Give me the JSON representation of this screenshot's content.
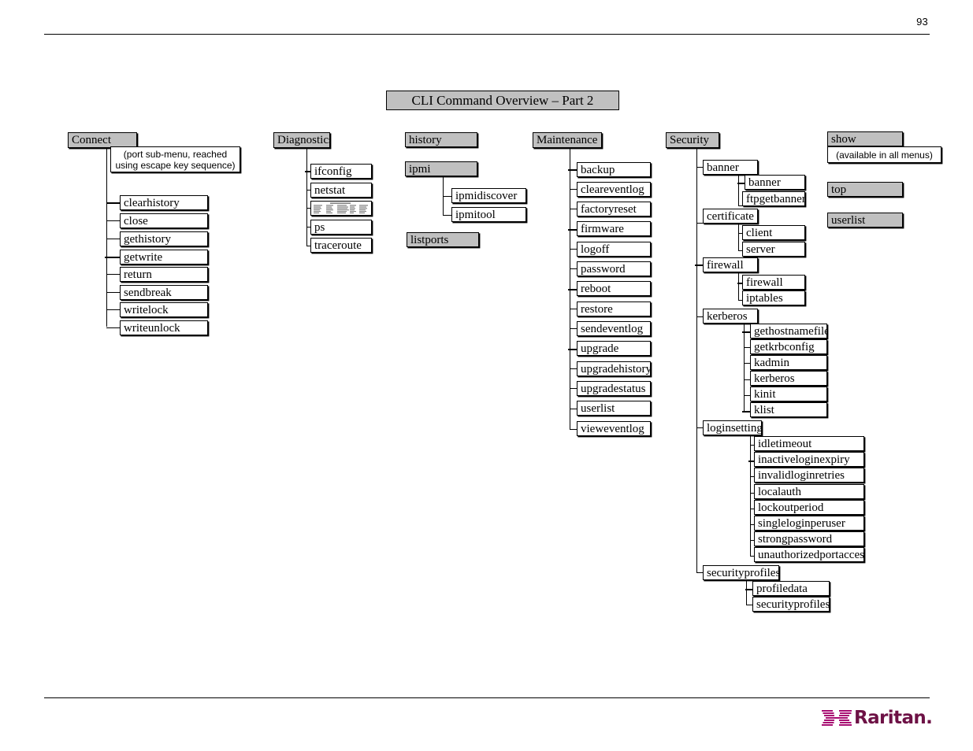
{
  "page": {
    "number": "93",
    "title": "CLI Command Overview – Part 2",
    "logo_text": "Raritan.",
    "logo_mark_name": "raritan-bowtie-logo-icon",
    "accent_color": "#6d1145",
    "logo_mark_color": "#a4006b",
    "header_box_color": "#c0c0c0"
  },
  "columns": [
    {
      "id": "connect",
      "root": "Connect",
      "note": "(port sub-menu, reached using escape key sequence)",
      "note_lines": [
        "(port sub-menu, reached",
        "using escape key sequence)"
      ],
      "children": [
        "clearhistory",
        "close",
        "gethistory",
        "getwrite",
        "return",
        "sendbreak",
        "writelock",
        "writeunlock"
      ]
    },
    {
      "id": "diagnostics",
      "root": "Diagnostics",
      "children": [
        "ifconfig",
        "netstat",
        "",
        "ps",
        "traceroute"
      ],
      "embedded_graphic_index": 2,
      "embedded_graphic_name": "netstat-output-thumbnail"
    },
    {
      "id": "history",
      "root": "history",
      "children": []
    },
    {
      "id": "ipmi",
      "root": "ipmi",
      "children": [
        "ipmidiscover",
        "ipmitool"
      ]
    },
    {
      "id": "listports",
      "root": "listports",
      "children": []
    },
    {
      "id": "maintenance",
      "root": "Maintenance",
      "children": [
        "backup",
        "cleareventlog",
        "factoryreset",
        "firmware",
        "logoff",
        "password",
        "reboot",
        "restore",
        "sendeventlog",
        "upgrade",
        "upgradehistory",
        "upgradestatus",
        "userlist",
        "vieweventlog"
      ]
    },
    {
      "id": "security",
      "root": "Security",
      "groups": [
        {
          "label": "banner",
          "children": [
            "banner",
            "ftpgetbanner"
          ]
        },
        {
          "label": "certificate",
          "children": [
            "client",
            "server"
          ]
        },
        {
          "label": "firewall",
          "children": [
            "firewall",
            "iptables"
          ]
        },
        {
          "label": "kerberos",
          "children": [
            "gethostnamefile",
            "getkrbconfig",
            "kadmin",
            "kerberos",
            "kinit",
            "klist"
          ]
        },
        {
          "label": "loginsetting",
          "children": [
            "idletimeout",
            "inactiveloginexpiry",
            "invalidloginretries",
            "localauth",
            "lockoutperiod",
            "singleloginperuser",
            "strongpassword",
            "unauthorizedportaccess"
          ]
        },
        {
          "label": "securityprofiles",
          "children": [
            "profiledata",
            "securityprofiles"
          ]
        }
      ]
    },
    {
      "id": "show",
      "root": "show",
      "note": "(available in all menus)",
      "children": []
    },
    {
      "id": "top",
      "root": "top",
      "children": []
    },
    {
      "id": "userlist",
      "root": "userlist",
      "children": []
    }
  ]
}
